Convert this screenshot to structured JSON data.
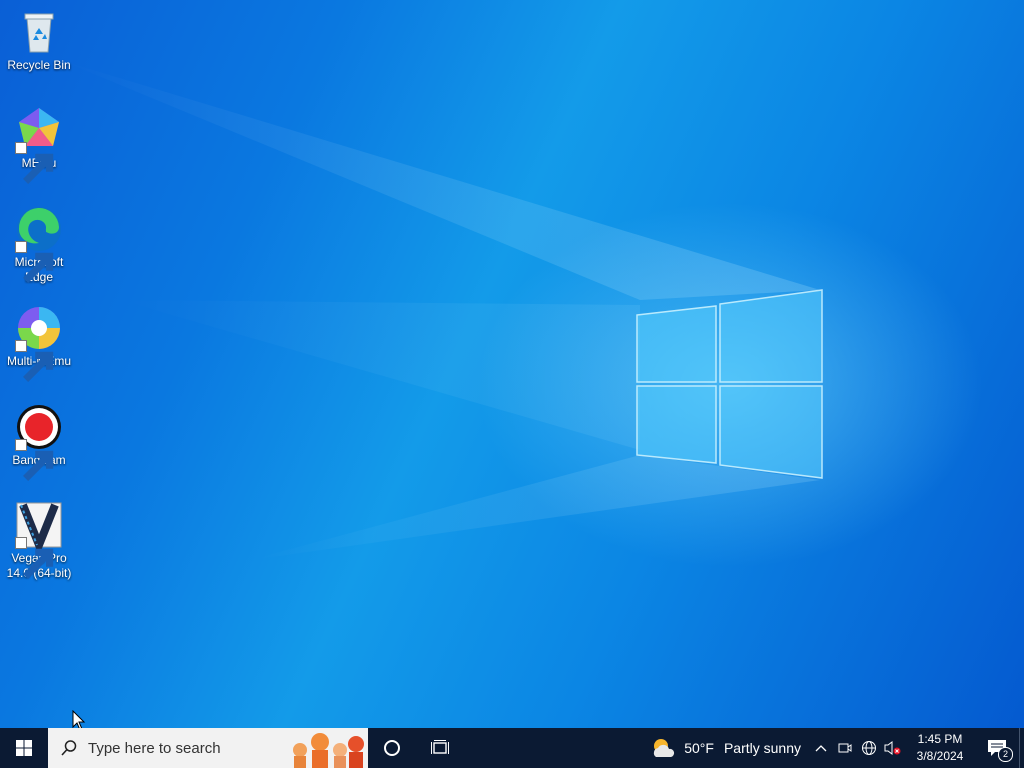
{
  "desktop": {
    "icons": [
      {
        "label": "Recycle Bin",
        "icon": "recycle-bin-icon",
        "shortcut": false
      },
      {
        "label": "MEmu",
        "icon": "memu-icon",
        "shortcut": true
      },
      {
        "label": "Microsoft Edge",
        "icon": "edge-icon",
        "shortcut": true
      },
      {
        "label": "Multi-MEmu",
        "icon": "multi-memu-icon",
        "shortcut": true
      },
      {
        "label": "Bandicam",
        "icon": "bandicam-icon",
        "shortcut": true
      },
      {
        "label": "Vegas Pro 14.0 (64-bit)",
        "icon": "vegas-pro-icon",
        "shortcut": true
      }
    ]
  },
  "taskbar": {
    "start_icon": "windows-logo-icon",
    "search_placeholder": "Type here to search",
    "weather": {
      "temp": "50°F",
      "condition": "Partly sunny",
      "icon": "partly-sunny-icon"
    },
    "clock": {
      "time": "1:45 PM",
      "date": "3/8/2024"
    },
    "notification_count": "2"
  },
  "colors": {
    "taskbar": "#0b1a33",
    "desktop_accent": "#0a78e0"
  }
}
